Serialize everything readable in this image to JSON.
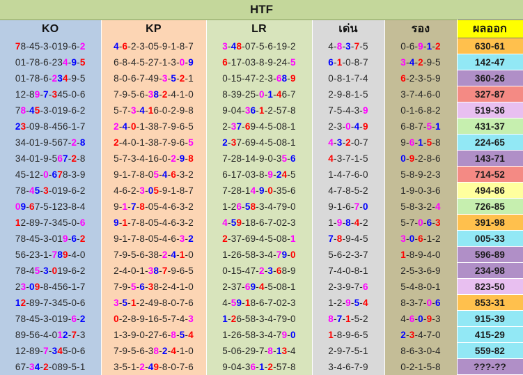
{
  "title": "HTF",
  "headers": {
    "ko": "KO",
    "kp": "KP",
    "lr": "LR",
    "den": "เด่น",
    "rong": "รอง",
    "result": "ผลออก"
  },
  "colors": {
    "red": "#ff0000",
    "blue": "#0000ff",
    "magenta": "#ff00ff",
    "orange": "#ffc04d",
    "cyan": "#92e8f5",
    "purple": "#b08fc7",
    "salmon": "#f48a84",
    "lavender": "#e8bff0",
    "green": "#c6efaf",
    "yellow": "#ffff9e"
  },
  "rows": [
    {
      "ko": "78-45-3-019-6-2",
      "kp": "4-6-2-3-05-9-1-8-7",
      "lr": "3-48-07-5-6-19-2",
      "den": "4-8-3-7-5",
      "rong": "0-6-9-1-2",
      "result": "630-61",
      "result_color": "orange"
    },
    {
      "ko": "01-78-6-234-9-5",
      "kp": "6-8-4-5-27-1-3-0-9",
      "lr": "6-17-03-8-9-24-5",
      "den": "6-1-0-8-7",
      "rong": "3-4-2-9-5",
      "result": "142-47",
      "result_color": "cyan"
    },
    {
      "ko": "01-78-6-234-9-5",
      "kp": "8-0-6-7-49-3-5-2-1",
      "lr": "0-15-47-2-3-68-9",
      "den": "0-8-1-7-4",
      "rong": "6-2-3-5-9",
      "result": "360-26",
      "result_color": "purple"
    },
    {
      "ko": "12-89-7-345-0-6",
      "kp": "7-9-5-6-38-2-4-1-0",
      "lr": "8-39-25-0-1-46-7",
      "den": "2-9-8-1-5",
      "rong": "3-7-4-6-0",
      "result": "327-87",
      "result_color": "salmon"
    },
    {
      "ko": "78-45-3-019-6-2",
      "kp": "5-7-3-4-16-0-2-9-8",
      "lr": "9-04-36-1-2-57-8",
      "den": "7-5-4-3-9",
      "rong": "0-1-6-8-2",
      "result": "519-36",
      "result_color": "lavender"
    },
    {
      "ko": "23-09-8-456-1-7",
      "kp": "2-4-0-1-38-7-9-6-5",
      "lr": "2-37-69-4-5-08-1",
      "den": "2-3-0-4-9",
      "rong": "6-8-7-5-1",
      "result": "431-37",
      "result_color": "green"
    },
    {
      "ko": "34-01-9-567-2-8",
      "kp": "2-4-0-1-38-7-9-6-5",
      "lr": "2-37-69-4-5-08-1",
      "den": "4-3-2-0-7",
      "rong": "9-6-1-5-8",
      "result": "224-65",
      "result_color": "cyan"
    },
    {
      "ko": "34-01-9-567-2-8",
      "kp": "5-7-3-4-16-0-2-9-8",
      "lr": "7-28-14-9-0-35-6",
      "den": "4-3-7-1-5",
      "rong": "0-9-2-8-6",
      "result": "143-71",
      "result_color": "purple"
    },
    {
      "ko": "45-12-0-678-3-9",
      "kp": "9-1-7-8-05-4-6-3-2",
      "lr": "6-17-03-8-9-24-5",
      "den": "1-4-7-6-0",
      "rong": "5-8-9-2-3",
      "result": "714-52",
      "result_color": "salmon"
    },
    {
      "ko": "78-45-3-019-6-2",
      "kp": "4-6-2-3-05-9-1-8-7",
      "lr": "7-28-14-9-0-35-6",
      "den": "4-7-8-5-2",
      "rong": "1-9-0-3-6",
      "result": "494-86",
      "result_color": "yellow"
    },
    {
      "ko": "09-67-5-123-8-4",
      "kp": "9-1-7-8-05-4-6-3-2",
      "lr": "1-26-58-3-4-79-0",
      "den": "9-1-6-7-0",
      "rong": "5-8-3-2-4",
      "result": "726-85",
      "result_color": "green"
    },
    {
      "ko": "12-89-7-345-0-6",
      "kp": "9-1-7-8-05-4-6-3-2",
      "lr": "4-59-18-6-7-02-3",
      "den": "1-9-8-4-2",
      "rong": "5-7-0-6-3",
      "result": "391-98",
      "result_color": "orange"
    },
    {
      "ko": "78-45-3-019-6-2",
      "kp": "9-1-7-8-05-4-6-3-2",
      "lr": "2-37-69-4-5-08-1",
      "den": "7-8-9-4-5",
      "rong": "3-0-6-1-2",
      "result": "005-33",
      "result_color": "cyan"
    },
    {
      "ko": "56-23-1-789-4-0",
      "kp": "7-9-5-6-38-2-4-1-0",
      "lr": "1-26-58-3-4-79-0",
      "den": "5-6-2-3-7",
      "rong": "1-8-9-4-0",
      "result": "596-89",
      "result_color": "purple"
    },
    {
      "ko": "78-45-3-019-6-2",
      "kp": "2-4-0-1-38-7-9-6-5",
      "lr": "0-15-47-2-3-68-9",
      "den": "7-4-0-8-1",
      "rong": "2-5-3-6-9",
      "result": "234-98",
      "result_color": "purple"
    },
    {
      "ko": "23-09-8-456-1-7",
      "kp": "7-9-5-6-38-2-4-1-0",
      "lr": "2-37-69-4-5-08-1",
      "den": "2-3-9-7-6",
      "rong": "5-4-8-0-1",
      "result": "823-50",
      "result_color": "lavender"
    },
    {
      "ko": "12-89-7-345-0-6",
      "kp": "3-5-1-2-49-8-0-7-6",
      "lr": "4-59-18-6-7-02-3",
      "den": "1-2-9-5-4",
      "rong": "8-3-7-0-6",
      "result": "853-31",
      "result_color": "orange"
    },
    {
      "ko": "78-45-3-019-6-2",
      "kp": "0-2-8-9-16-5-7-4-3",
      "lr": "1-26-58-3-4-79-0",
      "den": "8-7-1-5-2",
      "rong": "4-6-0-9-3",
      "result": "915-39",
      "result_color": "cyan"
    },
    {
      "ko": "89-56-4-012-7-3",
      "kp": "1-3-9-0-27-6-8-5-4",
      "lr": "1-26-58-3-4-79-0",
      "den": "1-8-9-6-5",
      "rong": "2-3-4-7-0",
      "result": "415-29",
      "result_color": "cyan"
    },
    {
      "ko": "12-89-7-345-0-6",
      "kp": "7-9-5-6-38-2-4-1-0",
      "lr": "5-06-29-7-8-13-4",
      "den": "2-9-7-5-1",
      "rong": "8-6-3-0-4",
      "result": "559-82",
      "result_color": "cyan"
    },
    {
      "ko": "67-34-2-089-5-1",
      "kp": "3-5-1-2-49-8-0-7-6",
      "lr": "9-04-36-1-2-57-8",
      "den": "3-4-6-7-9",
      "rong": "0-2-1-5-8",
      "result": "???-??",
      "result_color": "purple"
    }
  ]
}
